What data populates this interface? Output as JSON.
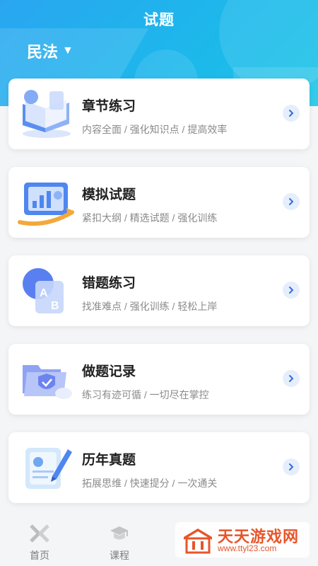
{
  "header": {
    "title": "试题",
    "subject": "民法",
    "dropdown_glyph": "▼"
  },
  "cards": [
    {
      "title": "章节练习",
      "desc": "内容全面 / 强化知识点 / 提高效率",
      "icon": "book-icon"
    },
    {
      "title": "模拟试题",
      "desc": "紧扣大纲 / 精选试题 / 强化训练",
      "icon": "chart-board-icon"
    },
    {
      "title": "错题练习",
      "desc": "找准难点 / 强化训练 / 轻松上岸",
      "icon": "ab-icon"
    },
    {
      "title": "做题记录",
      "desc": "练习有迹可循 / 一切尽在掌控",
      "icon": "folder-shield-icon"
    },
    {
      "title": "历年真题",
      "desc": "拓展思维 / 快速提分 / 一次通关",
      "icon": "exam-pen-icon"
    }
  ],
  "tabbar": [
    {
      "label": "首页",
      "icon": "x-logo-icon"
    },
    {
      "label": "课程",
      "icon": "graduation-cap-icon"
    }
  ],
  "watermark": {
    "title": "天天游戏网",
    "url": "www.ttyl23.com"
  },
  "colors": {
    "accent": "#2aa6f0",
    "chevron": "#2f6fdc",
    "watermark": "#e8552a"
  }
}
